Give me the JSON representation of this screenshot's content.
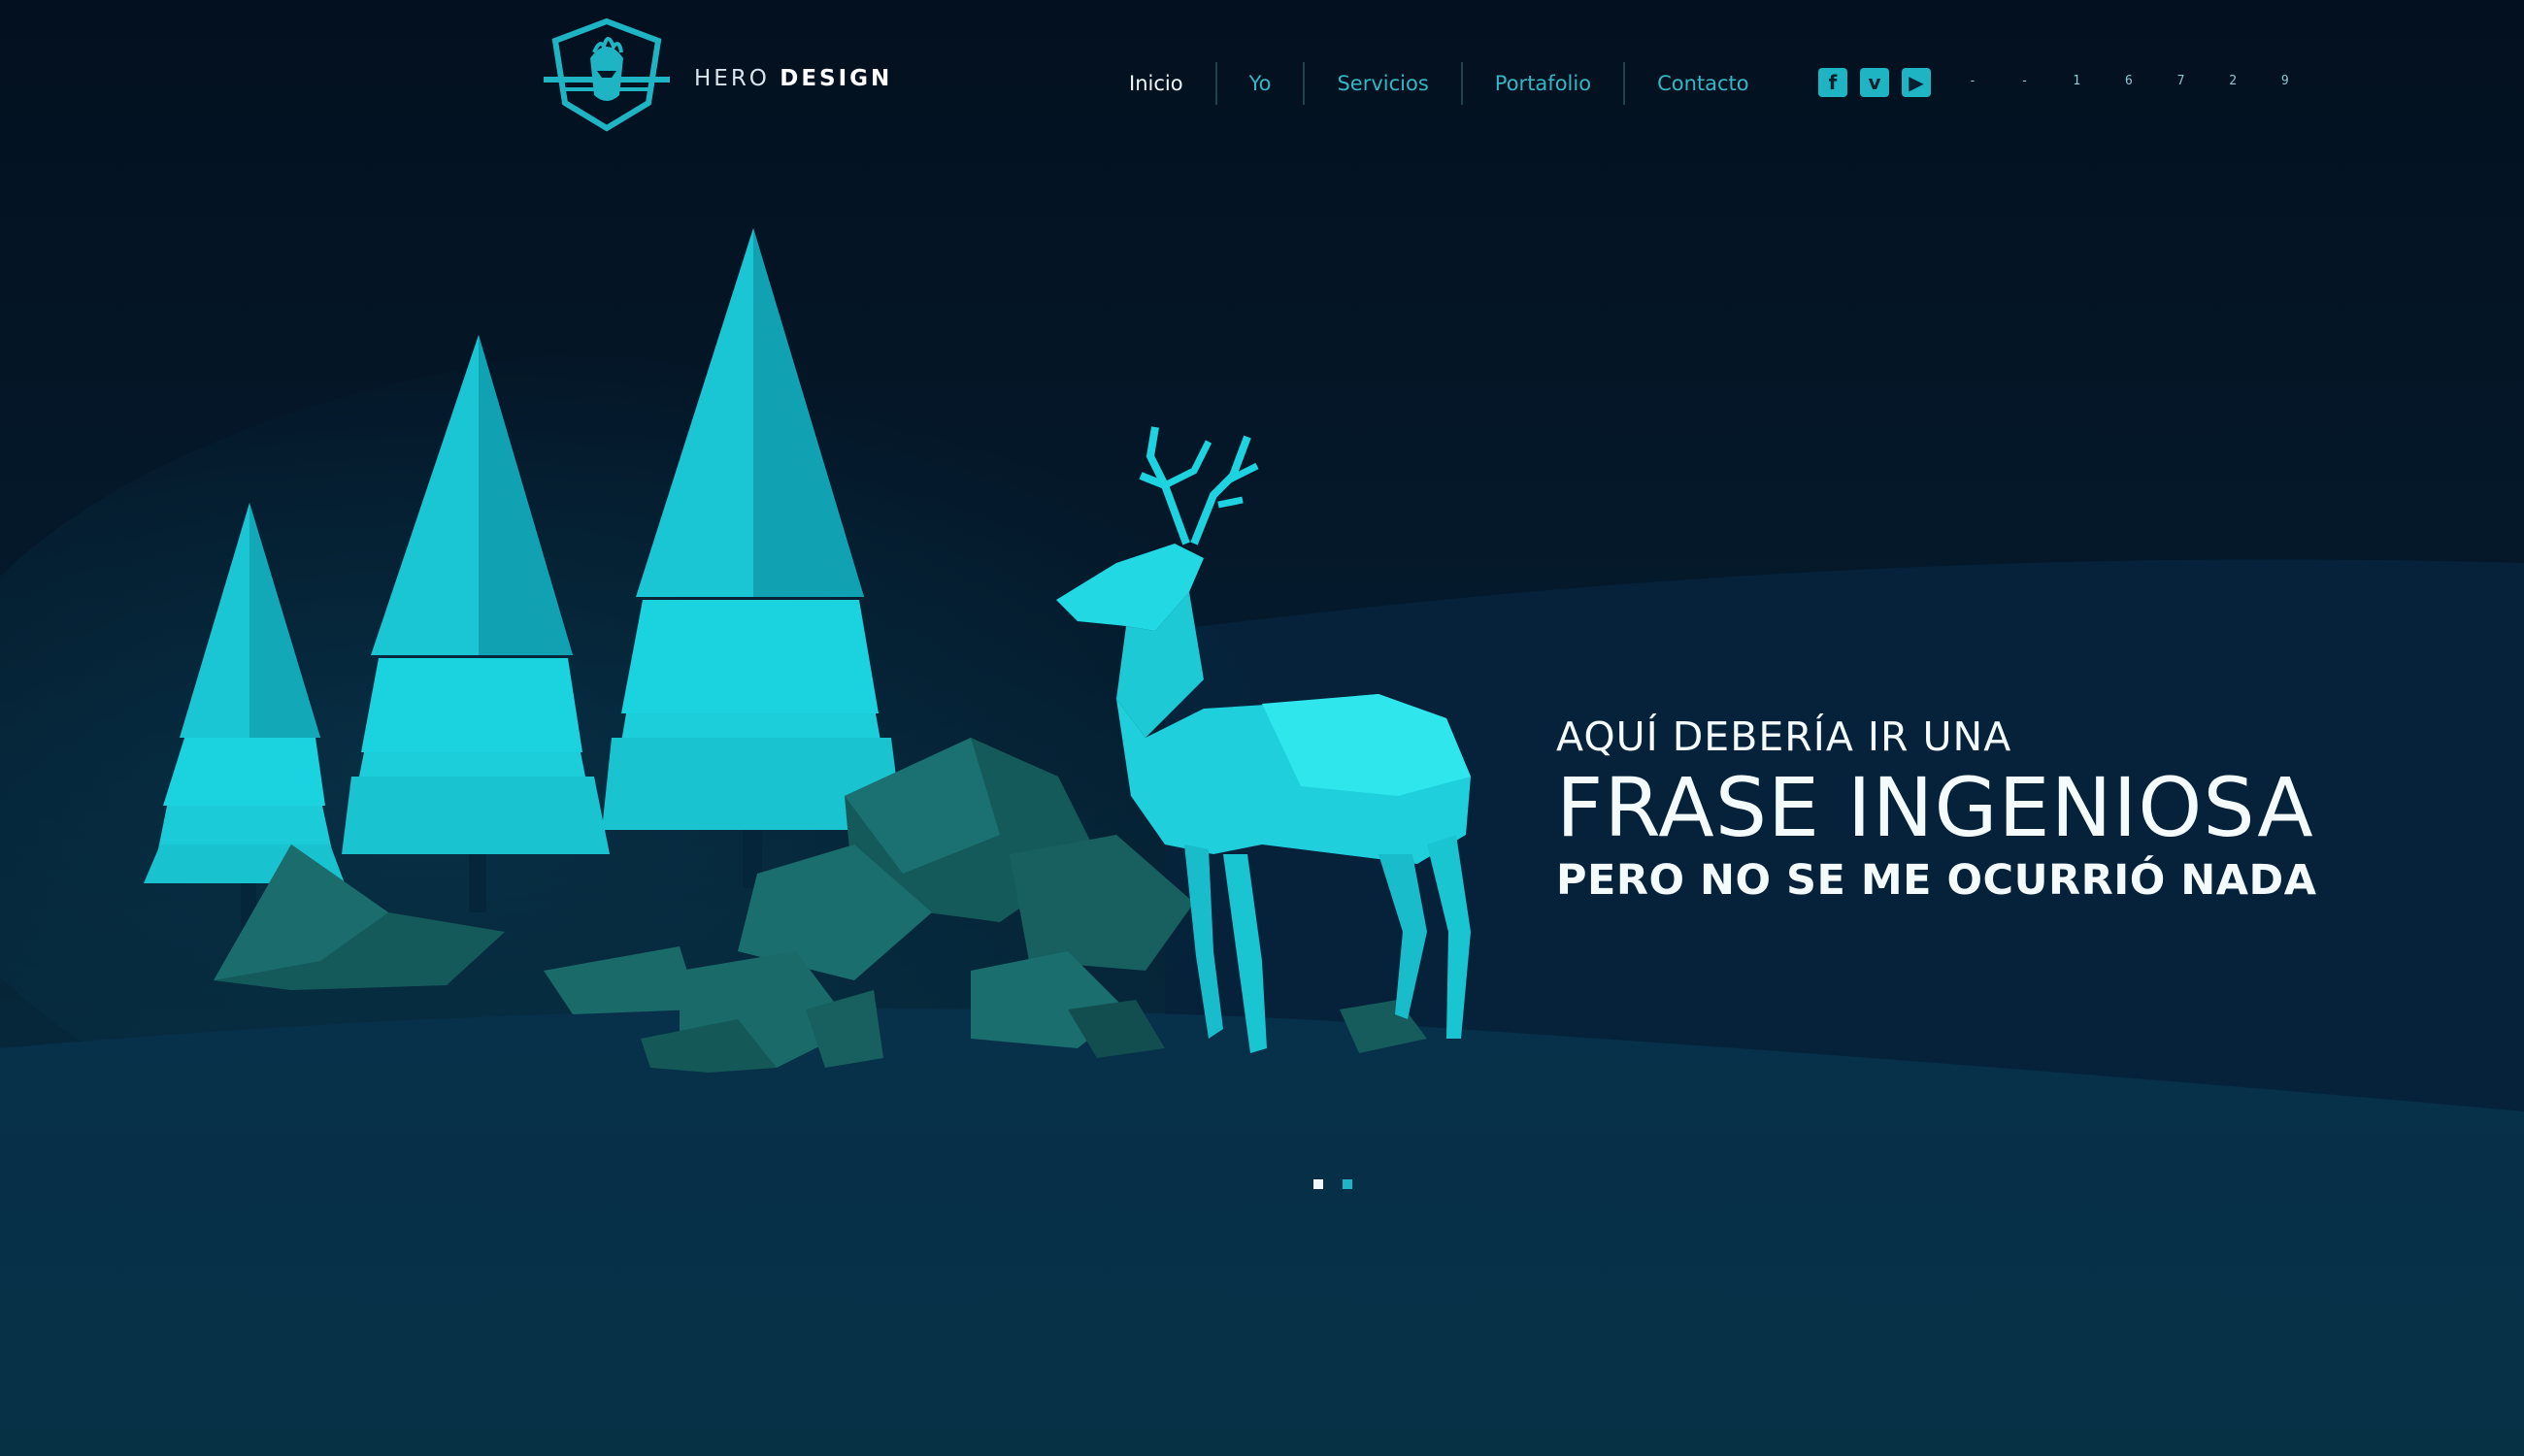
{
  "header": {
    "brand_light": "HERO",
    "brand_bold": "DESIGN",
    "phone": "- - 1 6 7 2 9"
  },
  "nav": {
    "items": [
      {
        "label": "Inicio",
        "active": true
      },
      {
        "label": "Yo",
        "active": false
      },
      {
        "label": "Servicios",
        "active": false
      },
      {
        "label": "Portafolio",
        "active": false
      },
      {
        "label": "Contacto",
        "active": false
      }
    ]
  },
  "social": [
    "facebook-icon",
    "vimeo-icon",
    "youtube-icon"
  ],
  "hero": {
    "line1": "AQUÍ DEBERÍA IR UNA",
    "line2": "FRASE INGENIOSA",
    "line3": "PERO NO SE ME OCURRIÓ NADA"
  },
  "slider": {
    "count": 2,
    "active_index": 0
  },
  "colors": {
    "accent": "#1fb4c4",
    "background": "#041526",
    "text": "#f4fbfd"
  }
}
